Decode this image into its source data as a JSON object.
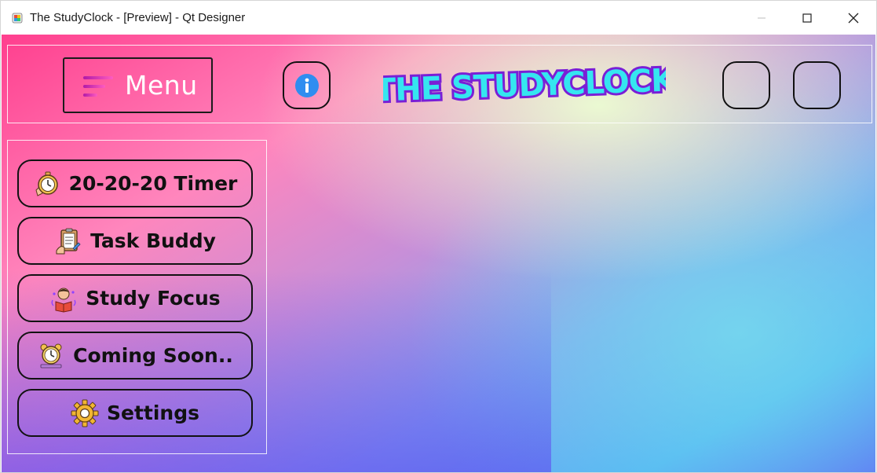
{
  "window": {
    "title": "The StudyClock - [Preview] - Qt Designer",
    "icon": "qt-designer-icon",
    "controls": [
      "minimize-icon",
      "maximize-icon",
      "close-icon"
    ]
  },
  "header": {
    "menu_label": "Menu",
    "menu_icon": "hamburger-icon",
    "info_icon": "info-icon",
    "logo_text": "THE STUDYCLOCK"
  },
  "sidebar": {
    "items": [
      {
        "label": "20-20-20 Timer",
        "icon": "stopwatch-icon"
      },
      {
        "label": "Task Buddy",
        "icon": "clipboard-icon"
      },
      {
        "label": "Study Focus",
        "icon": "reading-student-icon"
      },
      {
        "label": "Coming Soon..",
        "icon": "alarm-clock-icon"
      },
      {
        "label": "Settings",
        "icon": "gear-icon"
      }
    ]
  },
  "colors": {
    "pink": "#ff3f8e",
    "blue": "#4fb0f5",
    "violet": "#5a6cf5",
    "mint": "#ecffd2",
    "logo_fill": "#35e6f0",
    "logo_outline": "#7a1fd6",
    "border": "#121212"
  }
}
